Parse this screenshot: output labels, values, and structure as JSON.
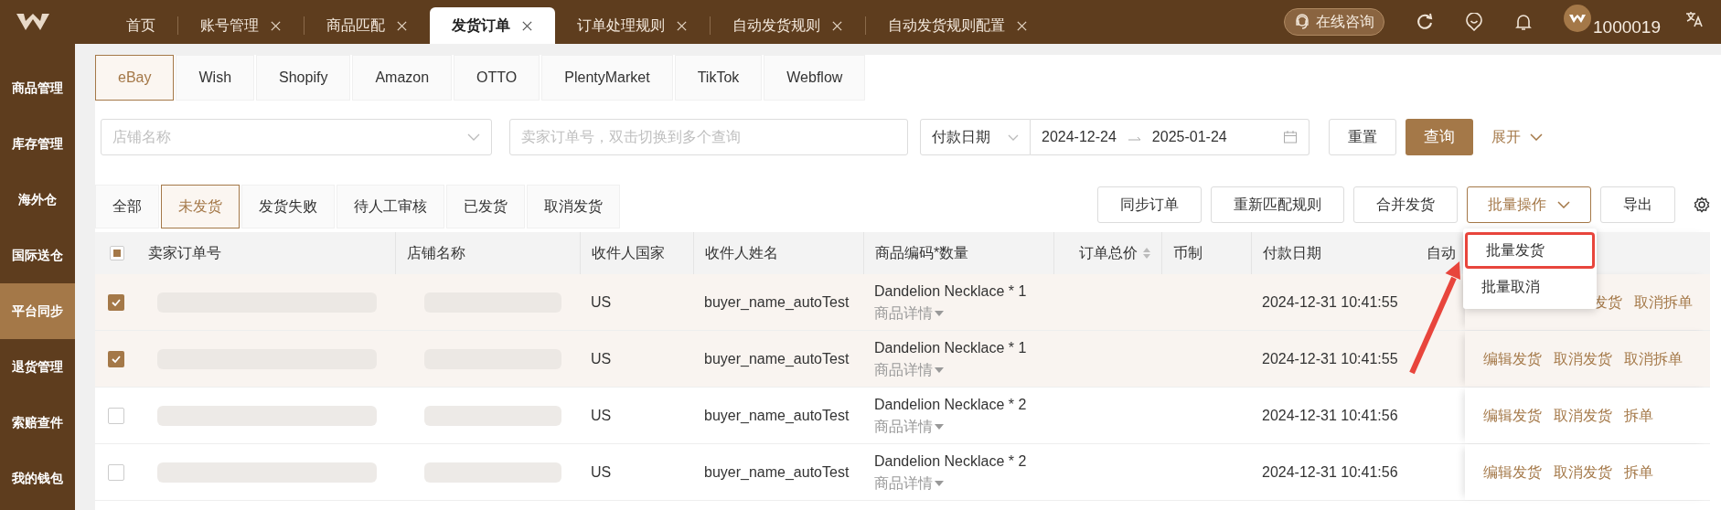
{
  "nav_tabs": [
    {
      "label": "首页",
      "closable": false,
      "selected": false
    },
    {
      "label": "账号管理",
      "closable": true,
      "selected": false
    },
    {
      "label": "商品匹配",
      "closable": true,
      "selected": false
    },
    {
      "label": "发货订单",
      "closable": true,
      "selected": true
    },
    {
      "label": "订单处理规则",
      "closable": true,
      "selected": false
    },
    {
      "label": "自动发货规则",
      "closable": true,
      "selected": false
    },
    {
      "label": "自动发货规则配置",
      "closable": true,
      "selected": false
    }
  ],
  "header": {
    "consult_button": "在线咨询",
    "user_id": "1000019"
  },
  "sidebar": [
    {
      "label": "商品管理",
      "selected": false
    },
    {
      "label": "库存管理",
      "selected": false
    },
    {
      "label": "海外仓",
      "selected": false
    },
    {
      "label": "国际送仓",
      "selected": false
    },
    {
      "label": "平台同步",
      "selected": true
    },
    {
      "label": "退货管理",
      "selected": false
    },
    {
      "label": "索赔查件",
      "selected": false
    },
    {
      "label": "我的钱包",
      "selected": false
    }
  ],
  "platform_tabs": [
    {
      "label": "eBay",
      "selected": true
    },
    {
      "label": "Wish",
      "selected": false
    },
    {
      "label": "Shopify",
      "selected": false
    },
    {
      "label": "Amazon",
      "selected": false
    },
    {
      "label": "OTTO",
      "selected": false
    },
    {
      "label": "PlentyMarket",
      "selected": false
    },
    {
      "label": "TikTok",
      "selected": false
    },
    {
      "label": "Webflow",
      "selected": false
    }
  ],
  "filters": {
    "store_placeholder": "店铺名称",
    "order_placeholder": "卖家订单号，双击切换到多个查询",
    "date_type": "付款日期",
    "date_start": "2024-12-24",
    "date_end": "2025-01-24",
    "reset": "重置",
    "search": "查询",
    "expand": "展开"
  },
  "status_tabs": [
    {
      "label": "全部",
      "selected": false
    },
    {
      "label": "未发货",
      "selected": true
    },
    {
      "label": "发货失败",
      "selected": false
    },
    {
      "label": "待人工审核",
      "selected": false
    },
    {
      "label": "已发货",
      "selected": false
    },
    {
      "label": "取消发货",
      "selected": false
    }
  ],
  "toolbar_buttons": [
    {
      "label": "同步订单",
      "kind": "plain"
    },
    {
      "label": "重新匹配规则",
      "kind": "plain"
    },
    {
      "label": "合并发货",
      "kind": "plain"
    },
    {
      "label": "批量操作",
      "kind": "dropdown"
    },
    {
      "label": "导出",
      "kind": "plain"
    }
  ],
  "batch_menu": {
    "items": [
      {
        "label": "批量发货",
        "highlighted": true
      },
      {
        "label": "批量取消",
        "highlighted": false
      }
    ],
    "pointer_arrow": true
  },
  "table": {
    "select_all_indeterminate": true,
    "columns": [
      {
        "label": "卖家订单号",
        "sortable": false
      },
      {
        "label": "店铺名称",
        "sortable": false
      },
      {
        "label": "收件人国家",
        "sortable": false
      },
      {
        "label": "收件人姓名",
        "sortable": false
      },
      {
        "label": "商品编码*数量",
        "sortable": false
      },
      {
        "label": "订单总价",
        "sortable": true
      },
      {
        "label": "币制",
        "sortable": false
      },
      {
        "label": "付款日期",
        "sortable": false
      },
      {
        "label": "自动",
        "sortable": false
      }
    ],
    "rows": [
      {
        "checked": true,
        "redacted": true,
        "country": "US",
        "recipient": "buyer_name_autoTest",
        "product": "Dandelion Necklace * 1",
        "details": "商品详情",
        "pay_date": "2024-12-31 10:41:55",
        "under_menu": true,
        "actions": [
          "发货",
          "取消拆单"
        ]
      },
      {
        "checked": true,
        "redacted": true,
        "country": "US",
        "recipient": "buyer_name_autoTest",
        "product": "Dandelion Necklace * 1",
        "details": "商品详情",
        "pay_date": "2024-12-31 10:41:55",
        "under_menu": false,
        "actions": [
          "编辑发货",
          "取消发货",
          "取消拆单"
        ]
      },
      {
        "checked": false,
        "redacted": true,
        "country": "US",
        "recipient": "buyer_name_autoTest",
        "product": "Dandelion Necklace * 2",
        "details": "商品详情",
        "pay_date": "2024-12-31 10:41:56",
        "under_menu": false,
        "actions": [
          "编辑发货",
          "取消发货",
          "拆单"
        ]
      },
      {
        "checked": false,
        "redacted": true,
        "country": "US",
        "recipient": "buyer_name_autoTest",
        "product": "Dandelion Necklace * 2",
        "details": "商品详情",
        "pay_date": "2024-12-31 10:41:56",
        "under_menu": false,
        "actions": [
          "编辑发货",
          "取消发货",
          "拆单"
        ]
      }
    ]
  }
}
